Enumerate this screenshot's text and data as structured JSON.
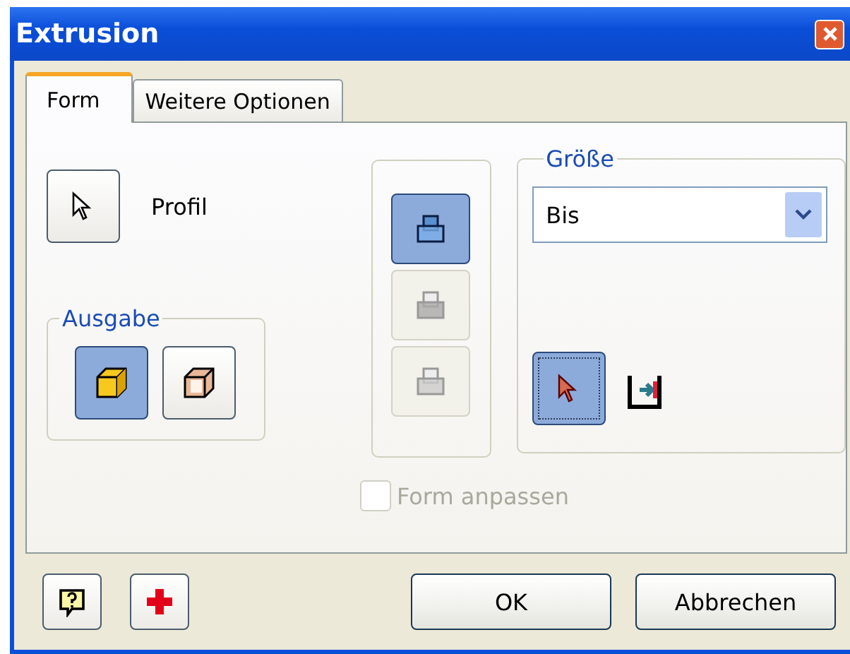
{
  "window": {
    "title": "Extrusion"
  },
  "tabs": [
    {
      "label": "Form",
      "selected": true
    },
    {
      "label": "Weitere Optionen",
      "selected": false
    }
  ],
  "profile": {
    "label": "Profil"
  },
  "output": {
    "title": "Ausgabe",
    "options": [
      {
        "kind": "solid",
        "selected": true
      },
      {
        "kind": "surface",
        "selected": false
      }
    ]
  },
  "direction": [
    {
      "kind": "one",
      "selected": true,
      "disabled": false
    },
    {
      "kind": "two",
      "selected": false,
      "disabled": true
    },
    {
      "kind": "mid",
      "selected": false,
      "disabled": true
    }
  ],
  "size": {
    "title": "Größe",
    "dropdown": {
      "value": "Bis"
    },
    "pick": {
      "selected": true
    }
  },
  "adapt": {
    "label": "Form anpassen",
    "checked": false,
    "disabled": true
  },
  "buttons": [
    "OK",
    "Abbrechen"
  ]
}
